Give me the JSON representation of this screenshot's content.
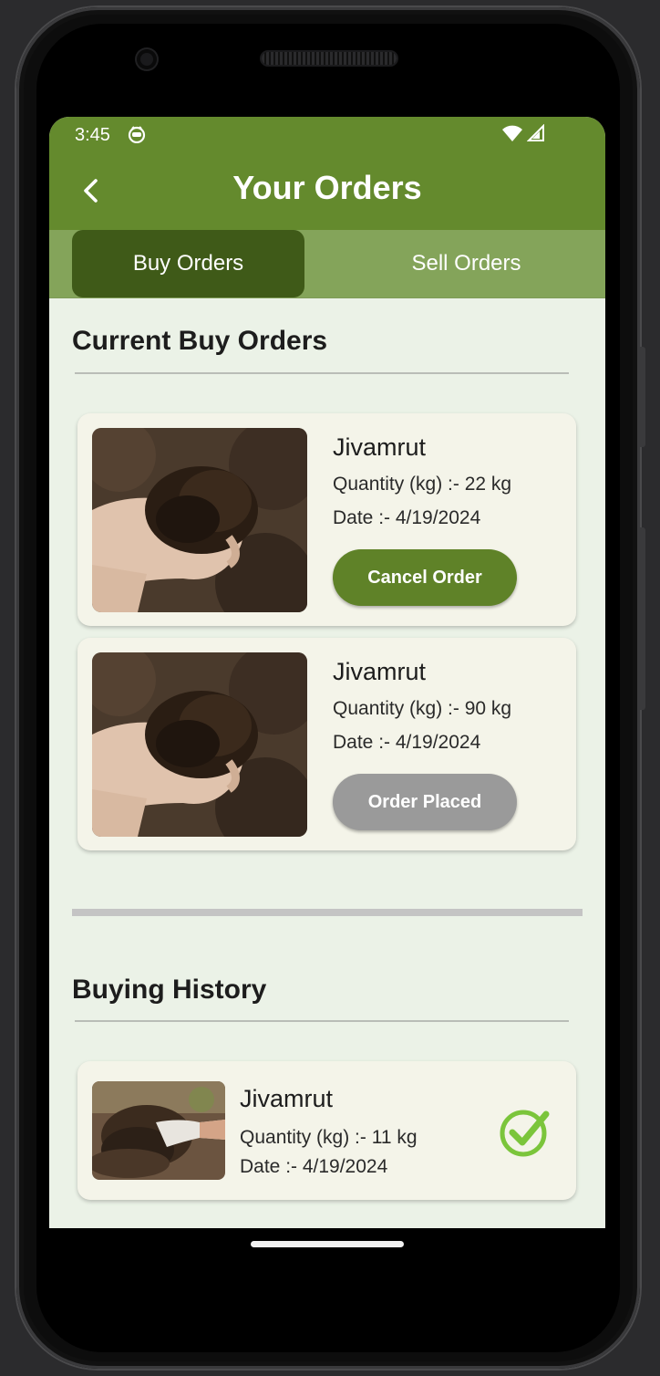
{
  "status": {
    "time": "3:45"
  },
  "header": {
    "title": "Your Orders"
  },
  "tabs": [
    {
      "label": "Buy Orders",
      "active": true
    },
    {
      "label": "Sell Orders",
      "active": false
    }
  ],
  "current": {
    "title": "Current Buy Orders",
    "orders": [
      {
        "name": "Jivamrut",
        "quantity": "Quantity (kg) :- 22 kg",
        "date": "Date :- 4/19/2024",
        "button": "Cancel Order",
        "button_color": "#5f8228"
      },
      {
        "name": "Jivamrut",
        "quantity": "Quantity (kg) :- 90 kg",
        "date": "Date :- 4/19/2024",
        "button": "Order Placed",
        "button_color": "#9a9a9a"
      }
    ]
  },
  "history": {
    "title": "Buying History",
    "items": [
      {
        "name": "Jivamrut",
        "quantity": "Quantity (kg) :- 11 kg",
        "date": "Date :- 4/19/2024",
        "icon": "check-circle-icon",
        "icon_color": "#7bc53b"
      }
    ]
  },
  "colors": {
    "primary": "#648a2d",
    "tab_bar": "#84a45a",
    "tab_active": "#3f5a18",
    "background": "#ebf2e7",
    "card": "#f4f4e9"
  }
}
